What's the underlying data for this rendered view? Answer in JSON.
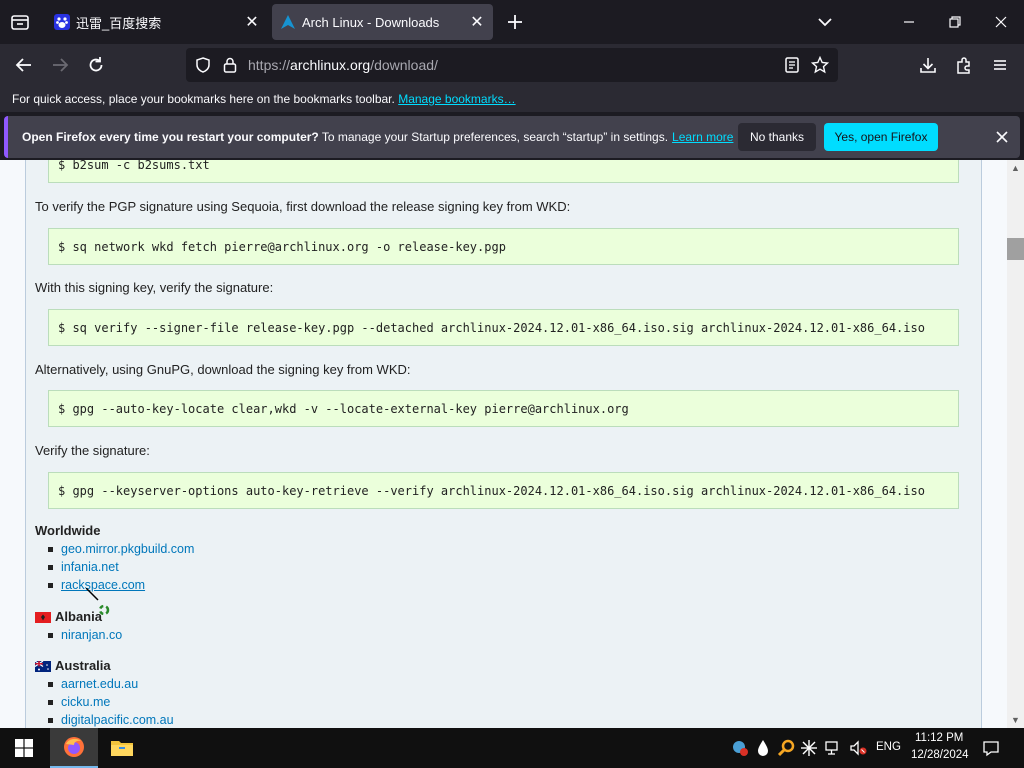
{
  "browser": {
    "tabs": [
      {
        "title": "迅雷_百度搜索",
        "active": false
      },
      {
        "title": "Arch Linux - Downloads",
        "active": true
      }
    ],
    "new_tab_icon": "plus-icon",
    "url_prefix": "https://",
    "url_host": "archlinux.org",
    "url_path": "/download/",
    "bookmarks_text": "For quick access, place your bookmarks here on the bookmarks toolbar.",
    "bookmarks_link": "Manage bookmarks…",
    "notification": {
      "bold": "Open Firefox every time you restart your computer?",
      "text": " To manage your Startup preferences, search “startup” in settings.",
      "learn_more": "Learn more",
      "no_thanks": "No thanks",
      "yes": "Yes, open Firefox"
    }
  },
  "page": {
    "code_blocks": [
      "$ b2sum -c b2sums.txt",
      "$ sq network wkd fetch pierre@archlinux.org -o release-key.pgp",
      "$ sq verify --signer-file release-key.pgp --detached archlinux-2024.12.01-x86_64.iso.sig archlinux-2024.12.01-x86_64.iso",
      "$ gpg --auto-key-locate clear,wkd -v --locate-external-key pierre@archlinux.org",
      "$ gpg --keyserver-options auto-key-retrieve --verify archlinux-2024.12.01-x86_64.iso.sig archlinux-2024.12.01-x86_64.iso"
    ],
    "paragraphs": [
      "To verify the PGP signature using Sequoia, first download the release signing key from WKD:",
      "With this signing key, verify the signature:",
      "Alternatively, using GnuPG, download the signing key from WKD:",
      "Verify the signature:"
    ],
    "mirrors": [
      {
        "region": "Worldwide",
        "flag": null,
        "links": [
          "geo.mirror.pkgbuild.com",
          "infania.net",
          "rackspace.com"
        ]
      },
      {
        "region": "Albania",
        "flag": "albania-flag",
        "links": [
          "niranjan.co"
        ]
      },
      {
        "region": "Australia",
        "flag": "australia-flag",
        "links": [
          "aarnet.edu.au",
          "cicku.me",
          "digitalpacific.com.au"
        ]
      }
    ]
  },
  "taskbar": {
    "language": "ENG",
    "time": "11:12 PM",
    "date": "12/28/2024"
  },
  "colors": {
    "accent": "#00ddff",
    "link": "#0077bb",
    "code_bg": "#ebffdb"
  }
}
